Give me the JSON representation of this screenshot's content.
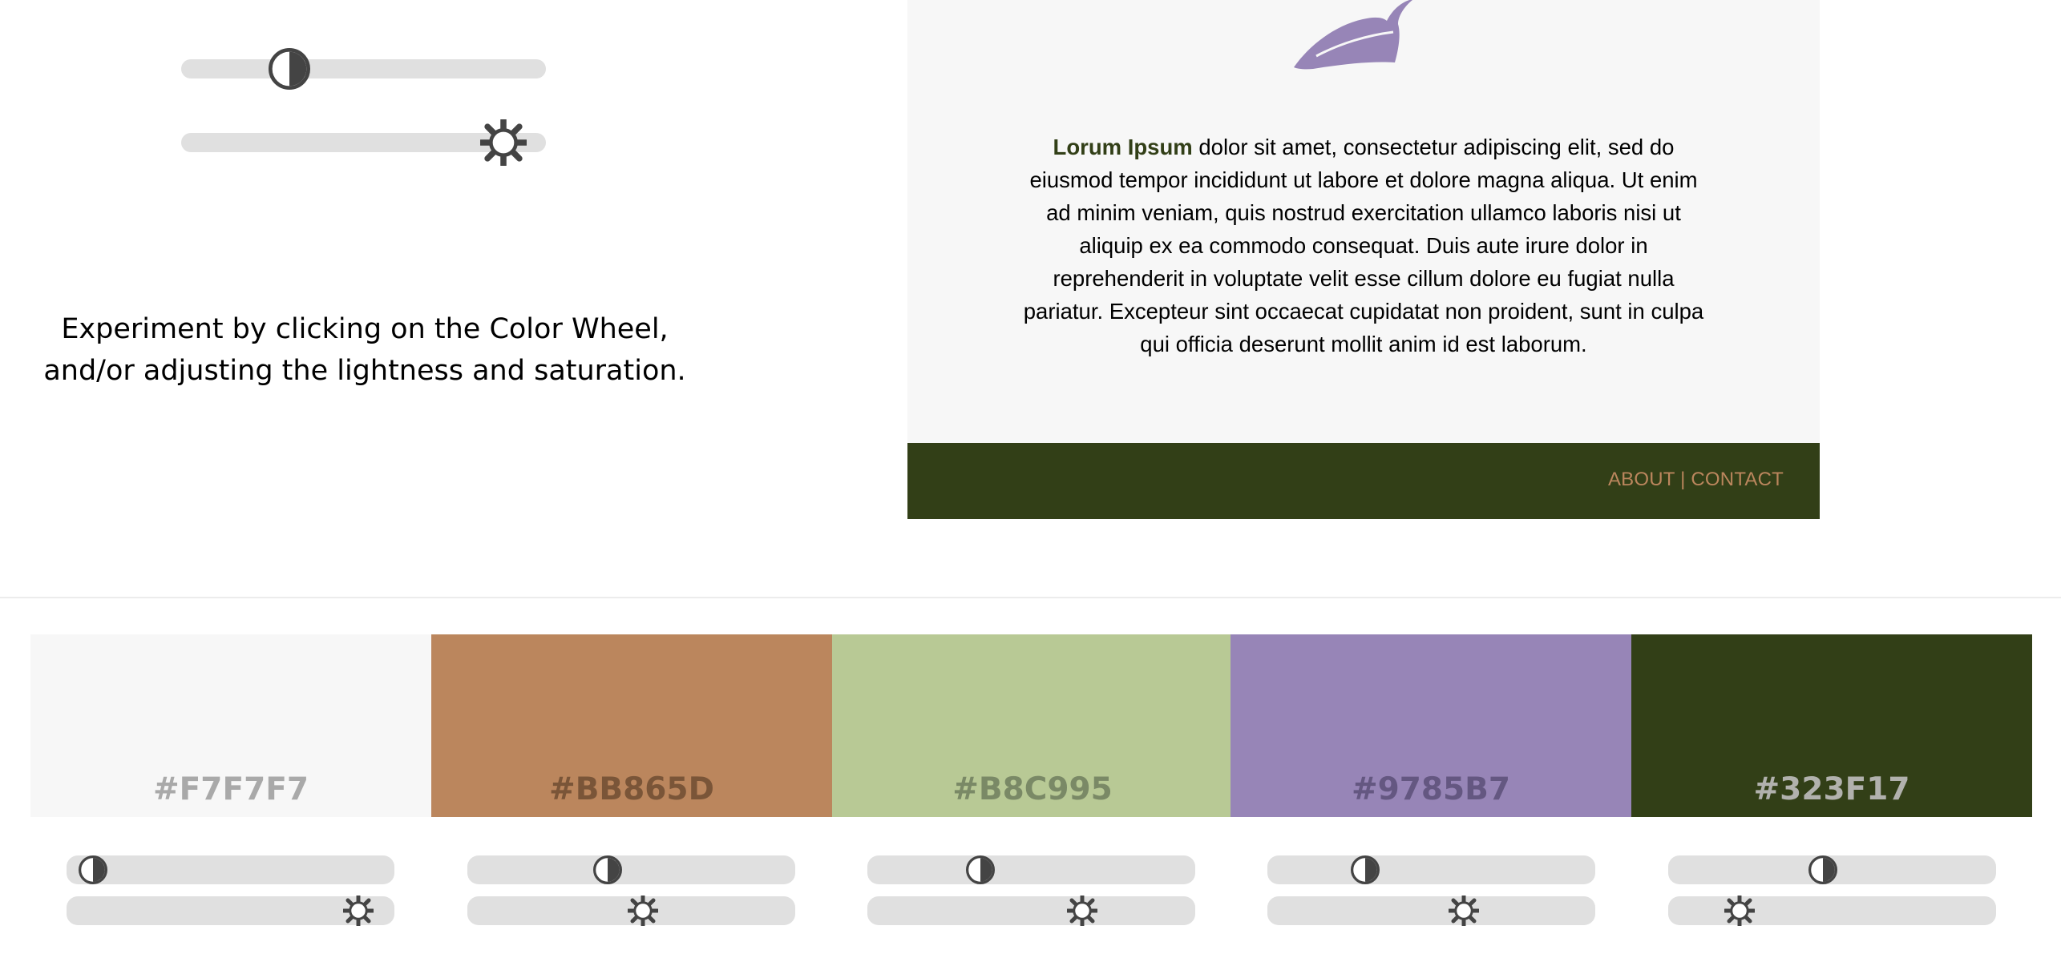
{
  "main_sliders": [
    {
      "name": "lightness",
      "icon": "contrast-icon",
      "value_fraction": 0.27
    },
    {
      "name": "saturation",
      "icon": "brightness-icon",
      "value_fraction": 0.94
    }
  ],
  "hint": {
    "line1": "Experiment by clicking on the Color Wheel,",
    "line2": "and/or adjusting the lightness and saturation."
  },
  "preview": {
    "bold_text": "Lorum Ipsum",
    "body_text": " dolor sit amet, consectetur adipiscing elit, sed do eiusmod tempor incididunt ut labore et dolore magna aliqua. Ut enim ad minim veniam, quis nostrud exercitation ullamco laboris nisi ut aliquip ex ea commodo consequat. Duis aute irure dolor in reprehenderit in voluptate velit esse cillum dolore eu fugiat nulla pariatur. Excepteur sint occaecat cupidatat non proident, sunt in culpa qui officia deserunt mollit anim id est laborum.",
    "footer_nav": "ABOUT | CONTACT",
    "background": "#F7F7F7",
    "footer_color": "#323F17",
    "link_color": "#BB865D",
    "leaf_color": "#9785B7",
    "leaf_icon": "leaf-icon"
  },
  "palette": [
    {
      "hex": "#F7F7F7",
      "label_color": "#a9a9a9",
      "lightness_fraction": 0.04,
      "saturation_fraction": 0.93
    },
    {
      "hex": "#BB865D",
      "label_color": "#7a5538",
      "lightness_fraction": 0.42,
      "saturation_fraction": 0.54
    },
    {
      "hex": "#B8C995",
      "label_color": "#7a8966",
      "lightness_fraction": 0.33,
      "saturation_fraction": 0.67
    },
    {
      "hex": "#9785B7",
      "label_color": "#645781",
      "lightness_fraction": 0.28,
      "saturation_fraction": 0.61
    },
    {
      "hex": "#323F17",
      "label_color": "#b1b1ad",
      "lightness_fraction": 0.47,
      "saturation_fraction": 0.19
    }
  ]
}
